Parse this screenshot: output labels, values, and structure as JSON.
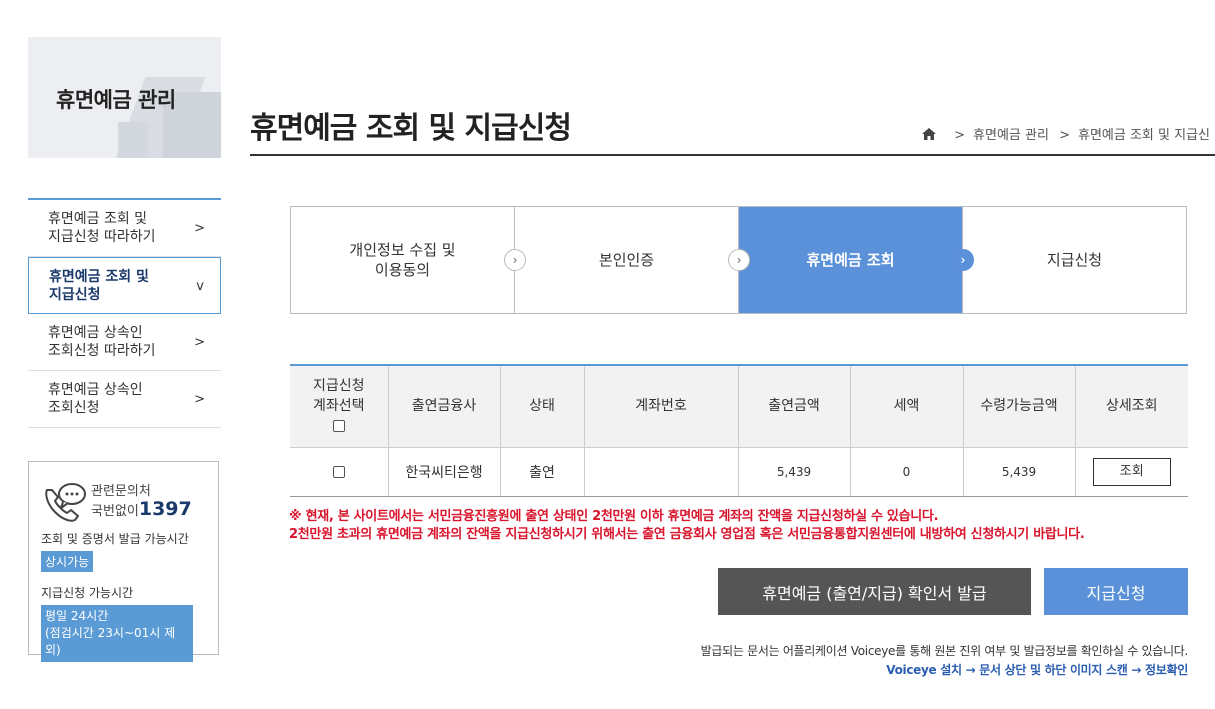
{
  "sidebar": {
    "banner_title": "휴면예금 관리",
    "items": [
      {
        "line1": "휴면예금 조회 및",
        "line2": "지급신청 따라하기",
        "arrow": ">"
      },
      {
        "line1": "휴면예금 조회 및",
        "line2": "지급신청",
        "arrow": "v"
      },
      {
        "line1": "휴면예금 상속인",
        "line2": "조회신청 따라하기",
        "arrow": ">"
      },
      {
        "line1": "휴면예금 상속인",
        "line2": "조회신청",
        "arrow": ">"
      }
    ],
    "active_index": 1
  },
  "contact": {
    "label1": "관련문의처",
    "label2": "국번없이",
    "phone": "1397",
    "hours_label": "조회 및 증명서 발급 가능시간",
    "hours_value": "상시가능",
    "apply_label": "지급신청 가능시간",
    "apply_value1": "평일 24시간",
    "apply_value2": "(점검시간 23시~01시 제외)"
  },
  "header": {
    "title": "휴면예금 조회 및 지급신청",
    "breadcrumb": [
      "휴면예금 관리",
      "휴면예금 조회 및 지급신"
    ],
    "breadcrumb_sep": ">"
  },
  "steps": [
    {
      "line1": "개인정보 수집 및",
      "line2": "이용동의"
    },
    {
      "line1": "본인인증",
      "line2": ""
    },
    {
      "line1": "휴면예금 조회",
      "line2": ""
    },
    {
      "line1": "지급신청",
      "line2": ""
    }
  ],
  "active_step": 2,
  "table": {
    "headers": {
      "select1": "지급신청",
      "select2": "계좌선택",
      "company": "출연금융사",
      "status": "상태",
      "account": "계좌번호",
      "amount": "출연금액",
      "tax": "세액",
      "receivable": "수령가능금액",
      "detail": "상세조회"
    },
    "rows": [
      {
        "company": "한국씨티은행",
        "status": "출연",
        "account": "",
        "amount": "5,439",
        "tax": "0",
        "receivable": "5,439",
        "detail": "조회"
      }
    ]
  },
  "notice": {
    "line1": "※ 현재, 본 사이트에서는 서민금융진흥원에 출연 상태인 2천만원 이하 휴면예금 계좌의 잔액을 지급신청하실 수 있습니다.",
    "line2": "2천만원 초과의 휴면예금 계좌의 잔액을 지급신청하시기 위해서는 출연 금융회사 영업점 혹은 서민금융통합지원센터에 내방하여 신청하시기 바랍니다."
  },
  "buttons": {
    "certificate": "휴면예금 (출연/지급) 확인서 발급",
    "apply": "지급신청"
  },
  "footer": {
    "line1": "발급되는 문서는 어플리케이션 Voiceye를 통해 원본 진위 여부 및 발급정보를 확인하실 수 있습니다.",
    "line2": "Voiceye 설치 → 문서 상단 및 하단 이미지 스캔 → 정보확인"
  },
  "colors": {
    "accent": "#5b91d8",
    "warning": "#d9142c",
    "dark_button": "#555555",
    "link": "#2a5db0"
  }
}
